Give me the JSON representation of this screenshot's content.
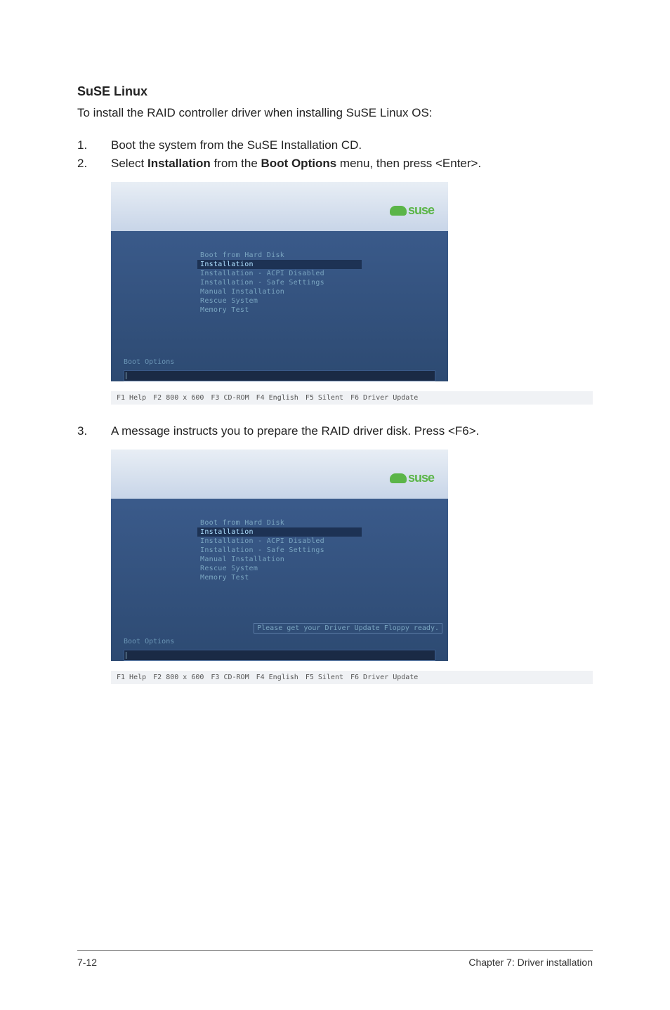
{
  "heading": "SuSE Linux",
  "intro": "To install the RAID controller driver when installing SuSE Linux OS:",
  "steps": {
    "s1": {
      "num": "1.",
      "text": "Boot the system from the SuSE Installation CD."
    },
    "s2": {
      "num": "2.",
      "prefix": "Select ",
      "bold1": "Installation",
      "mid": " from the ",
      "bold2": "Boot Options",
      "suffix": " menu, then press <Enter>."
    },
    "s3": {
      "num": "3.",
      "text": "A message instructs you to prepare the RAID driver disk. Press <F6>."
    }
  },
  "bootmenu": {
    "logo": "suse",
    "items": {
      "i0": "Boot from Hard Disk",
      "i1": "Installation",
      "i2": "Installation - ACPI Disabled",
      "i3": "Installation - Safe Settings",
      "i4": "Manual Installation",
      "i5": "Rescue System",
      "i6": "Memory Test"
    },
    "boot_options_label": "Boot Options",
    "driver_prompt": "Please get your Driver Update Floppy ready."
  },
  "fkeys": {
    "f1": "F1 Help",
    "f2": "F2 800 x 600",
    "f3": "F3 CD-ROM",
    "f4": "F4 English",
    "f5": "F5 Silent",
    "f6": "F6 Driver Update"
  },
  "footer": {
    "left": "7-12",
    "right": "Chapter 7: Driver installation"
  }
}
